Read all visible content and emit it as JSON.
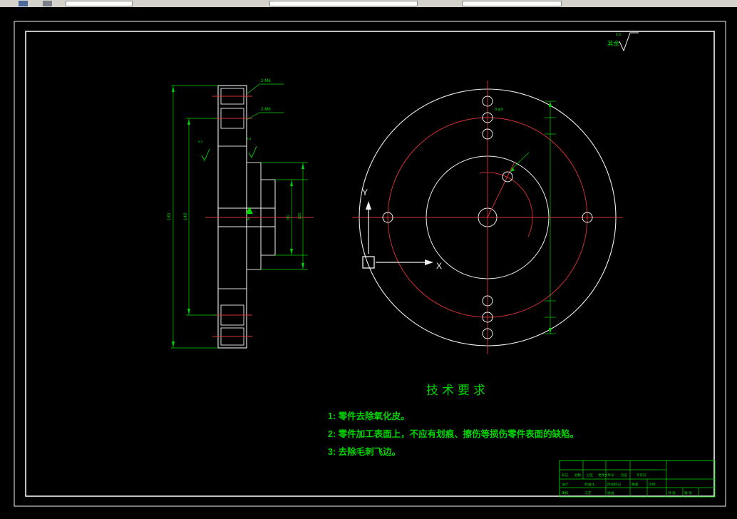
{
  "colors": {
    "bg": "#000000",
    "white": "#f0f0f0",
    "green": "#00d400",
    "red": "#dd3333",
    "toolbar": "#d5d2cb"
  },
  "drawing": {
    "surface_note": {
      "label": "其余",
      "value": "6.3"
    },
    "axes": {
      "x_label": "X",
      "y_label": "Y"
    },
    "left_view": {
      "leader1": "2-M6",
      "leader2": "2-M8",
      "dim_outer": "180",
      "dim_bolt": "140",
      "dim_hub_inner": "95",
      "dim_hub_outer": "120",
      "finish1": "6.3",
      "finish2": "6.3",
      "datum": "A"
    },
    "front_view": {
      "holes_label": "8-φ9"
    },
    "tech_requirements": {
      "title": "技术要求",
      "items": [
        "1: 零件去除氧化皮。",
        "2: 零件加工表面上，不应有划痕、擦伤等损伤零件表面的缺陷。",
        "3: 去除毛刺飞边。"
      ]
    },
    "title_block": {
      "r1": [
        "标记",
        "处数",
        "分区",
        "更改文件号",
        "签名",
        "年月日"
      ],
      "r2": [
        "设计",
        "标准化",
        "阶段标记",
        "重量",
        "比例"
      ],
      "r3": [
        "审核",
        "工艺",
        "批准"
      ],
      "sheet": [
        "共 张",
        "第 张"
      ]
    }
  }
}
